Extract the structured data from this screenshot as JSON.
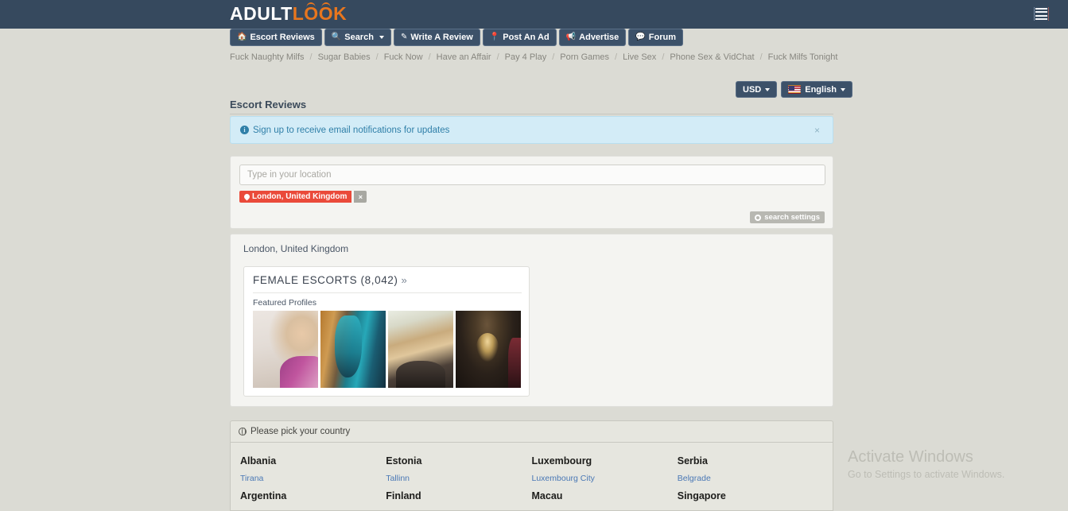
{
  "header": {
    "logo_white": "ADULT",
    "logo_orange": "LOOK",
    "menu_icon": "hamburger-menu-icon"
  },
  "nav": {
    "items": [
      {
        "label": "Escort Reviews",
        "icon": "home-icon",
        "has_caret": false
      },
      {
        "label": "Search",
        "icon": "search-icon",
        "has_caret": true
      },
      {
        "label": "Write A Review",
        "icon": "pencil-icon",
        "has_caret": false
      },
      {
        "label": "Post An Ad",
        "icon": "pin-icon",
        "has_caret": false
      },
      {
        "label": "Advertise",
        "icon": "megaphone-icon",
        "has_caret": false
      },
      {
        "label": "Forum",
        "icon": "comment-icon",
        "has_caret": false
      }
    ]
  },
  "sublinks": [
    "Fuck Naughty Milfs",
    "Sugar Babies",
    "Fuck Now",
    "Have an Affair",
    "Pay 4 Play",
    "Porn Games",
    "Live Sex",
    "Phone Sex & VidChat",
    "Fuck Milfs Tonight"
  ],
  "utilities": {
    "currency": "USD",
    "language": "English",
    "flag_icon": "us-flag-icon"
  },
  "page": {
    "title": "Escort Reviews"
  },
  "alert": {
    "icon": "info-circle-icon",
    "message": "Sign up to receive email notifications for updates",
    "close_label": "×"
  },
  "search": {
    "placeholder": "Type in your location",
    "value": "",
    "tag": {
      "icon": "location-pin-icon",
      "label": "London, United Kingdom",
      "remove_label": "×"
    },
    "settings_button": {
      "icon": "gear-icon",
      "label": "search settings"
    }
  },
  "results": {
    "city_heading": "London, United Kingdom",
    "card": {
      "title": "FEMALE ESCORTS (8,042)",
      "chevron": "»",
      "featured_label": "Featured Profiles",
      "thumbnails": [
        {
          "alt": "blonde-escort-thumbnail-1"
        },
        {
          "alt": "teal-hair-escort-thumbnail-2"
        },
        {
          "alt": "blonde-lace-escort-thumbnail-3"
        },
        {
          "alt": "chandelier-escort-thumbnail-4"
        }
      ]
    }
  },
  "countries": {
    "header_icon": "globe-icon",
    "header_label": "Please pick your country",
    "columns": [
      {
        "country": "Albania",
        "city": "Tirana",
        "country2": "Argentina"
      },
      {
        "country": "Estonia",
        "city": "Tallinn",
        "country2": "Finland"
      },
      {
        "country": "Luxembourg",
        "city": "Luxembourg City",
        "country2": "Macau"
      },
      {
        "country": "Serbia",
        "city": "Belgrade",
        "country2": "Singapore"
      }
    ]
  },
  "watermark": {
    "line1": "Activate Windows",
    "line2": "Go to Settings to activate Windows."
  },
  "colors": {
    "header_bg": "#36495e",
    "accent_orange": "#e8761e",
    "page_bg": "#dbdbd4",
    "tag_red": "#ea4a3a",
    "alert_bg": "#d3ecf7",
    "link_blue": "#4a78b5"
  }
}
